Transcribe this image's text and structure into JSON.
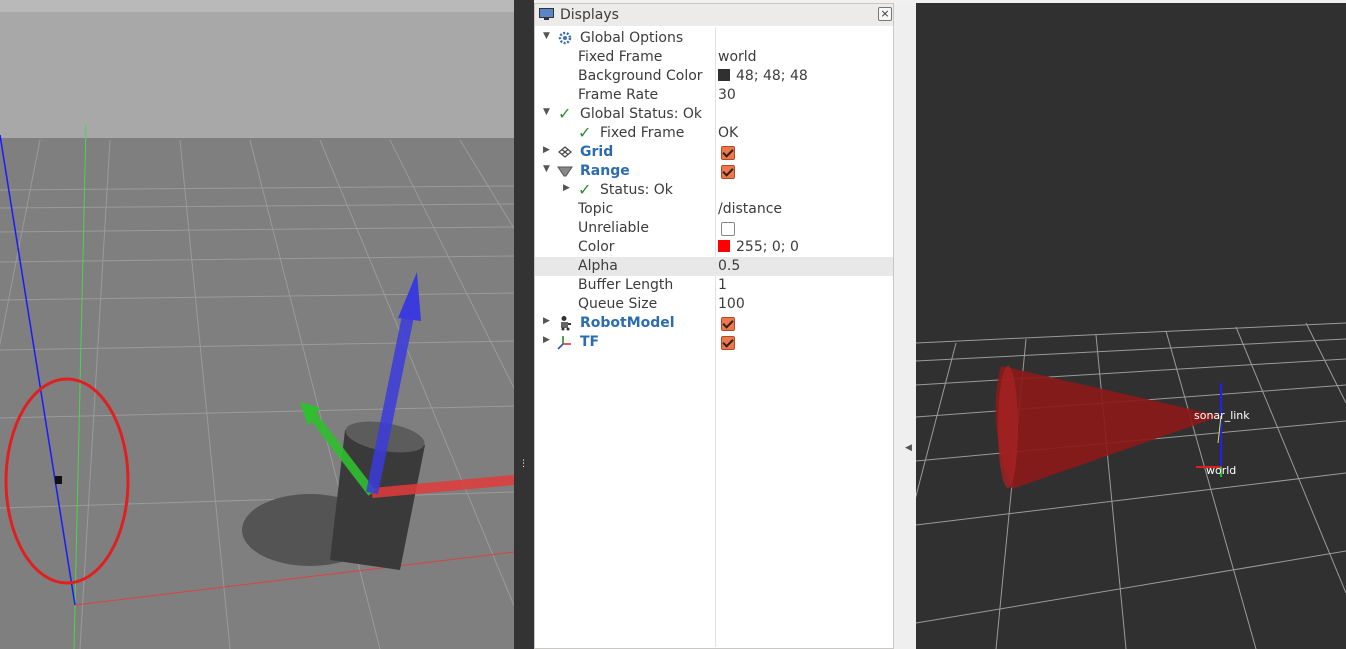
{
  "panel": {
    "title": "Displays",
    "close_symbol": "×"
  },
  "tree": {
    "global_options": "Global Options",
    "fixed_frame_label": "Fixed Frame",
    "fixed_frame_value": "world",
    "background_color_label": "Background Color",
    "background_color_value": "48; 48; 48",
    "background_color_hex": "#303030",
    "frame_rate_label": "Frame Rate",
    "frame_rate_value": "30",
    "global_status": "Global Status: Ok",
    "fixed_frame_status_label": "Fixed Frame",
    "fixed_frame_status_value": "OK",
    "grid": {
      "label": "Grid",
      "enabled": true
    },
    "range": {
      "label": "Range",
      "enabled": true
    },
    "range_status": "Status: Ok",
    "topic_label": "Topic",
    "topic_value": "/distance",
    "unreliable_label": "Unreliable",
    "unreliable_checked": false,
    "color_label": "Color",
    "color_value": "255; 0; 0",
    "color_hex": "#ff0000",
    "alpha_label": "Alpha",
    "alpha_value": "0.5",
    "buffer_length_label": "Buffer Length",
    "buffer_length_value": "1",
    "queue_size_label": "Queue Size",
    "queue_size_value": "100",
    "robot_model": {
      "label": "RobotModel",
      "enabled": true
    },
    "tf": {
      "label": "TF",
      "enabled": true
    }
  },
  "rviz": {
    "frames": [
      "sonar_link",
      "world"
    ]
  },
  "icons": {
    "monitor": "monitor-icon",
    "gear": "gear-icon",
    "check": "✓",
    "expand": "▶",
    "collapse": "▼",
    "grip": "⋮",
    "panel_collapse": "◀"
  }
}
